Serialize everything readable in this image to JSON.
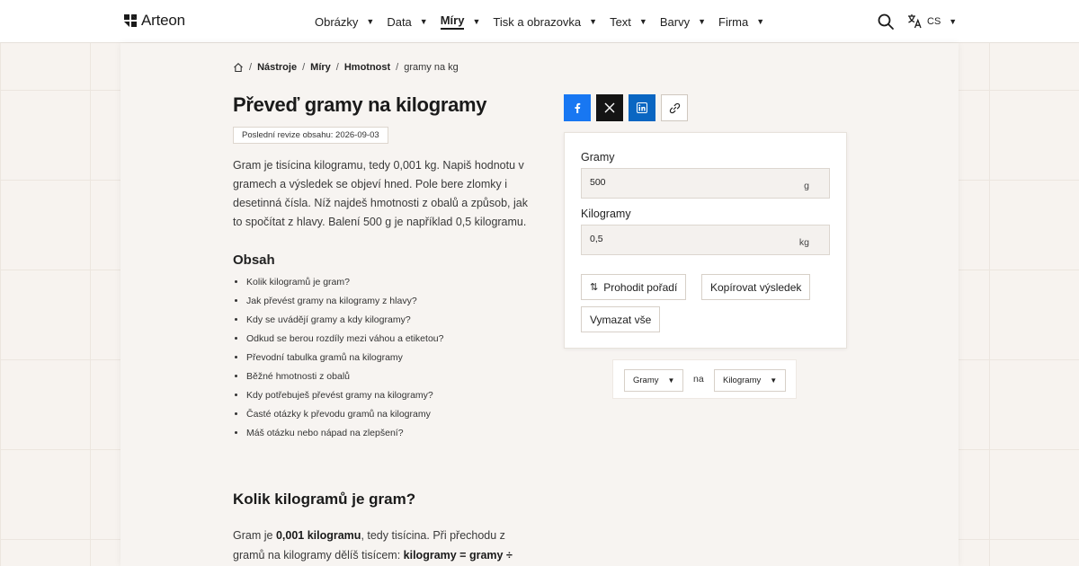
{
  "header": {
    "logo_text": "Arteon",
    "nav": [
      {
        "label": "Obrázky",
        "active": false
      },
      {
        "label": "Data",
        "active": false
      },
      {
        "label": "Míry",
        "active": true
      },
      {
        "label": "Tisk a obrazovka",
        "active": false
      },
      {
        "label": "Text",
        "active": false
      },
      {
        "label": "Barvy",
        "active": false
      },
      {
        "label": "Firma",
        "active": false
      }
    ],
    "language": "CS"
  },
  "breadcrumb": {
    "items": [
      "Nástroje",
      "Míry",
      "Hmotnost"
    ],
    "current": "gramy na kg"
  },
  "page": {
    "title": "Převeď gramy na kilogramy",
    "revision": "Poslední revize obsahu: 2026-09-03",
    "intro": "Gram je tisícina kilogramu, tedy 0,001 kg. Napiš hodnotu v gramech a výsledek se objeví hned. Pole bere zlomky i desetinná čísla. Níž najdeš hmotnosti z obalů a způsob, jak to spočítat z hlavy. Balení 500 g je například 0,5 kilogramu."
  },
  "toc": {
    "title": "Obsah",
    "items": [
      "Kolik kilogramů je gram?",
      "Jak převést gramy na kilogramy z hlavy?",
      "Kdy se uvádějí gramy a kdy kilogramy?",
      "Odkud se berou rozdíly mezi váhou a etiketou?",
      "Převodní tabulka gramů na kilogramy",
      "Běžné hmotnosti z obalů",
      "Kdy potřebuješ převést gramy na kilogramy?",
      "Časté otázky k převodu gramů na kilogramy",
      "Máš otázku nebo nápad na zlepšení?"
    ]
  },
  "section": {
    "title": "Kolik kilogramů je gram?",
    "p1": "Gram je ",
    "p1_bold": "0,001 kilogramu",
    "p2": ", tedy tisícina. Při přechodu z gramů na kilogramy dělíš tisícem: ",
    "p2_bold": "kilogramy = gramy ÷"
  },
  "converter": {
    "from_label": "Gramy",
    "from_value": "500",
    "from_unit": "g",
    "to_label": "Kilogramy",
    "to_value": "0,5",
    "to_unit": "kg",
    "swap_label": "Prohodit pořadí",
    "copy_label": "Kopírovat výsledek",
    "clear_label": "Vymazat vše"
  },
  "unit_select": {
    "from": "Gramy",
    "joiner": "na",
    "to": "Kilogramy"
  },
  "colors": {
    "facebook": "#1877f2",
    "x": "#141414",
    "linkedin": "#0a66c2"
  }
}
